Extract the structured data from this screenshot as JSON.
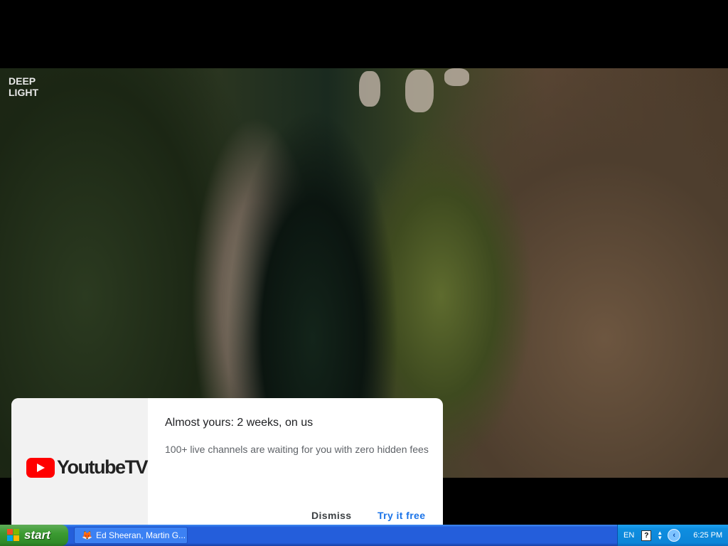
{
  "video": {
    "channel_logo_line1": "DEEP",
    "channel_logo_line2": "LIGHT"
  },
  "promo": {
    "brand_name": "YoutubeTV",
    "title": "Almost yours: 2 weeks, on us",
    "description": "100+ live channels are waiting for you with zero hidden fees",
    "dismiss_label": "Dismiss",
    "try_label": "Try it free",
    "accent_color": "#1a73e8",
    "brand_color": "#ff0000"
  },
  "taskbar": {
    "start_label": "start",
    "window_item_label": "Ed Sheeran, Martin G...",
    "window_item_icon": "firefox-icon",
    "language": "EN",
    "help_icon_glyph": "?",
    "clock": "6:25 PM"
  }
}
